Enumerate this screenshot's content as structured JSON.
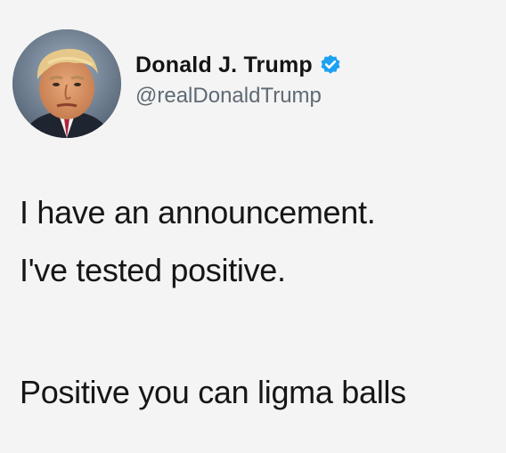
{
  "tweet": {
    "author": {
      "display_name": "Donald J. Trump",
      "handle": "@realDonaldTrump",
      "verified": true,
      "avatar_icon": "profile-photo",
      "verified_icon": "verified-badge-icon"
    },
    "lines": [
      "I have an announcement.",
      "I've tested positive.",
      "Positive you can ligma balls"
    ]
  },
  "colors": {
    "background": "#f4f4f4",
    "text": "#161616",
    "handle": "#5f6a74",
    "verified_badge": "#1da1f2"
  }
}
